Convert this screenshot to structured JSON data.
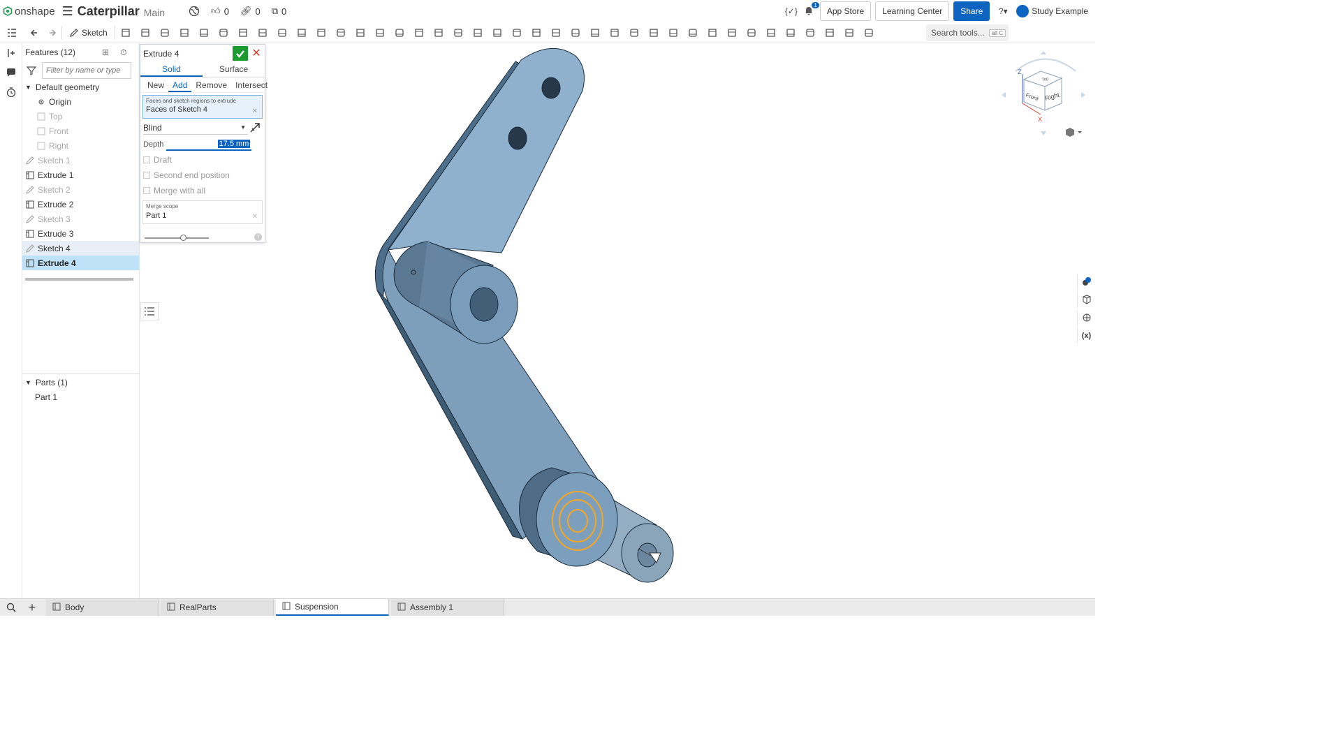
{
  "app": {
    "brand": "onshape",
    "doc_title": "Caterpillar",
    "branch": "Main"
  },
  "top_stats": {
    "likes": "0",
    "links": "0",
    "copies": "0"
  },
  "top_right": {
    "app_store": "App Store",
    "learning_center": "Learning Center",
    "share": "Share",
    "notif_count": "1",
    "user": "Study Example"
  },
  "toolbar": {
    "sketch_label": "Sketch",
    "search_label": "Search tools...",
    "search_kbd": "alt C"
  },
  "features": {
    "header": "Features (12)",
    "filter_placeholder": "Filter by name or type",
    "default_geometry": "Default geometry",
    "items": [
      {
        "label": "Origin",
        "kind": "origin"
      },
      {
        "label": "Top",
        "kind": "plane"
      },
      {
        "label": "Front",
        "kind": "plane"
      },
      {
        "label": "Right",
        "kind": "plane"
      },
      {
        "label": "Sketch 1",
        "kind": "sketch"
      },
      {
        "label": "Extrude 1",
        "kind": "extrude"
      },
      {
        "label": "Sketch 2",
        "kind": "sketch"
      },
      {
        "label": "Extrude 2",
        "kind": "extrude"
      },
      {
        "label": "Sketch 3",
        "kind": "sketch"
      },
      {
        "label": "Extrude 3",
        "kind": "extrude"
      },
      {
        "label": "Sketch 4",
        "kind": "sketch"
      },
      {
        "label": "Extrude 4",
        "kind": "extrude"
      }
    ],
    "parts_header": "Parts (1)",
    "parts": [
      "Part 1"
    ]
  },
  "dialog": {
    "title": "Extrude 4",
    "tab_solid": "Solid",
    "tab_surface": "Surface",
    "op_new": "New",
    "op_add": "Add",
    "op_remove": "Remove",
    "op_intersect": "Intersect",
    "faces_label": "Faces and sketch regions to extrude",
    "faces_value": "Faces of Sketch 4",
    "end_type": "Blind",
    "depth_label": "Depth",
    "depth_value": "17.5 mm",
    "draft": "Draft",
    "second_end": "Second end position",
    "merge_all": "Merge with all",
    "scope_label": "Merge scope",
    "scope_value": "Part 1",
    "slider_value": 0.6
  },
  "viewcube": {
    "z": "Z",
    "x": "X",
    "front": "Front",
    "right": "Right",
    "top": "Top"
  },
  "bottom_tabs": [
    {
      "label": "Body",
      "active": false
    },
    {
      "label": "RealParts",
      "active": false
    },
    {
      "label": "Suspension",
      "active": true
    },
    {
      "label": "Assembly 1",
      "active": false
    }
  ],
  "colors": {
    "accent": "#0b64c0",
    "part_face": "#7fa3c2",
    "part_dark": "#4b6a85",
    "selection": "#f5a623",
    "ok": "#1c9a32",
    "cancel": "#d93b2b"
  }
}
